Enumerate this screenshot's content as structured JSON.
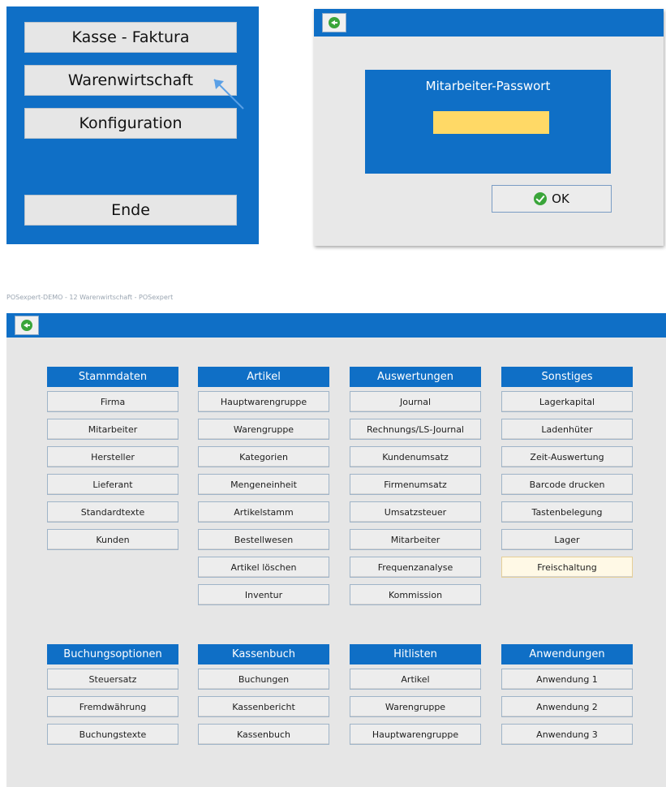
{
  "menu": {
    "buttons": [
      "Kasse - Faktura",
      "Warenwirtschaft",
      "Konfiguration",
      "Ende"
    ]
  },
  "password_dialog": {
    "title": "Mitarbeiter-Passwort",
    "ok_label": "OK",
    "input_value": ""
  },
  "main_window": {
    "title": "POSexpert-DEMO - 12 Warenwirtschaft - POSexpert",
    "groups": [
      {
        "title": "Stammdaten",
        "items": [
          "Firma",
          "Mitarbeiter",
          "Hersteller",
          "Lieferant",
          "Standardtexte",
          "Kunden"
        ]
      },
      {
        "title": "Artikel",
        "items": [
          "Hauptwarengruppe",
          "Warengruppe",
          "Kategorien",
          "Mengeneinheit",
          "Artikelstamm",
          "Bestellwesen",
          "Artikel löschen",
          "Inventur"
        ]
      },
      {
        "title": "Auswertungen",
        "items": [
          "Journal",
          "Rechnungs/LS-Journal",
          "Kundenumsatz",
          "Firmenumsatz",
          "Umsatzsteuer",
          "Mitarbeiter",
          "Frequenzanalyse",
          "Kommission"
        ]
      },
      {
        "title": "Sonstiges",
        "items": [
          "Lagerkapital",
          "Ladenhüter",
          "Zeit-Auswertung",
          "Barcode drucken",
          "Tastenbelegung",
          "Lager",
          "Freischaltung"
        ]
      },
      {
        "title": "Buchungsoptionen",
        "items": [
          "Steuersatz",
          "Fremdwährung",
          "Buchungstexte"
        ]
      },
      {
        "title": "Kassenbuch",
        "items": [
          "Buchungen",
          "Kassenbericht",
          "Kassenbuch"
        ]
      },
      {
        "title": "Hitlisten",
        "items": [
          "Artikel",
          "Warengruppe",
          "Hauptwarengruppe"
        ]
      },
      {
        "title": "Anwendungen",
        "items": [
          "Anwendung 1",
          "Anwendung 2",
          "Anwendung 3"
        ]
      }
    ]
  },
  "colors": {
    "brand_blue": "#0f6fc6",
    "password_field": "#ffd966",
    "highlight": "#fff9e6"
  }
}
